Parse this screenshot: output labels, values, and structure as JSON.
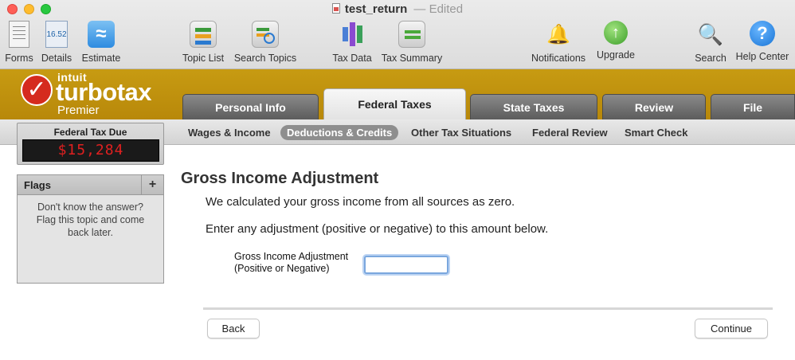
{
  "window": {
    "document_name": "test_return",
    "separator": "—",
    "status": "Edited"
  },
  "toolbar": {
    "forms": "Forms",
    "details": "Details",
    "details_icon_text": "16.52",
    "estimate": "Estimate",
    "topic_list": "Topic List",
    "search_topics": "Search Topics",
    "tax_data": "Tax Data",
    "tax_summary": "Tax Summary",
    "notifications": "Notifications",
    "upgrade": "Upgrade",
    "search": "Search",
    "help_center": "Help Center"
  },
  "brand": {
    "intuit": "intuit",
    "product": "turbotax",
    "edition": "Premier"
  },
  "main_tabs": [
    {
      "label": "Personal Info"
    },
    {
      "label": "Federal Taxes"
    },
    {
      "label": "State Taxes"
    },
    {
      "label": "Review"
    },
    {
      "label": "File"
    }
  ],
  "sub_tabs": [
    {
      "label": "Wages & Income"
    },
    {
      "label": "Deductions & Credits"
    },
    {
      "label": "Other Tax Situations"
    },
    {
      "label": "Federal Review"
    },
    {
      "label": "Smart Check"
    }
  ],
  "tax_due": {
    "label": "Federal Tax Due",
    "amount": "$15,284"
  },
  "flags": {
    "title": "Flags",
    "add": "+",
    "message": "Don't know the answer? Flag this topic and come back later."
  },
  "content": {
    "heading": "Gross Income Adjustment",
    "line1": "We calculated your gross income from all sources as zero.",
    "line2": "Enter any adjustment (positive or negative) to this amount below.",
    "field_label_1": "Gross Income Adjustment",
    "field_label_2": "(Positive or Negative)",
    "field_value": ""
  },
  "buttons": {
    "back": "Back",
    "continue": "Continue"
  },
  "colors": {
    "brand_gold": "#c09210",
    "tax_due_red": "#e02020",
    "check_red": "#d52b1e"
  }
}
